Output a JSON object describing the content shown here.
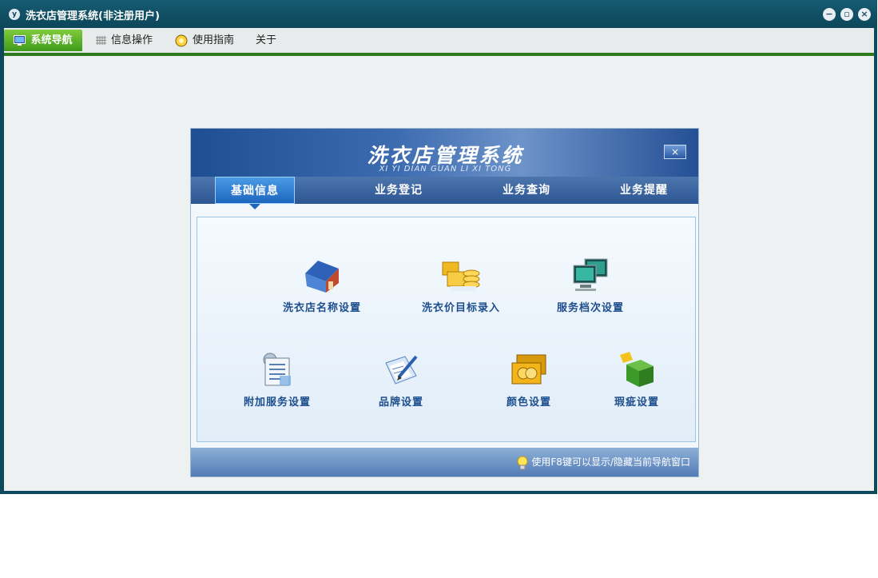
{
  "window": {
    "title": "洗衣店管理系统(非注册用户)",
    "app_icon": "app-logo-icon",
    "controls": [
      "minimize-icon",
      "restore-icon",
      "close-icon"
    ]
  },
  "menubar": {
    "items": [
      {
        "label": "系统导航",
        "icon": "monitor-icon",
        "active": true
      },
      {
        "label": "信息操作",
        "icon": "grid-icon",
        "active": false
      },
      {
        "label": "使用指南",
        "icon": "help-icon",
        "active": false
      },
      {
        "label": "关于",
        "icon": "",
        "active": false
      }
    ]
  },
  "dialog": {
    "title": "洗衣店管理系统",
    "subtitle": "XI YI DIAN GUAN LI XI TONG",
    "close_label": "×",
    "tabs": [
      {
        "label": "基础信息",
        "active": true
      },
      {
        "label": "业务登记",
        "active": false
      },
      {
        "label": "业务查询",
        "active": false
      },
      {
        "label": "业务提醒",
        "active": false
      }
    ],
    "tiles": [
      {
        "label": "洗衣店名称设置",
        "icon": "house-icon"
      },
      {
        "label": "洗衣价目标录入",
        "icon": "coins-icon"
      },
      {
        "label": "服务档次设置",
        "icon": "computers-icon"
      },
      {
        "label": "附加服务设置",
        "icon": "document-gear-icon"
      },
      {
        "label": "品牌设置",
        "icon": "pen-paper-icon"
      },
      {
        "label": "颜色设置",
        "icon": "gold-card-icon"
      },
      {
        "label": "瑕疵设置",
        "icon": "green-cube-icon"
      }
    ],
    "tip": "使用F8键可以显示/隐藏当前导航窗口"
  },
  "colors": {
    "titlebar": "#0e4a5e",
    "menu_accent": "#2c7a1e",
    "dialog_header": "#2c5593",
    "label_text": "#1d4e8d"
  }
}
